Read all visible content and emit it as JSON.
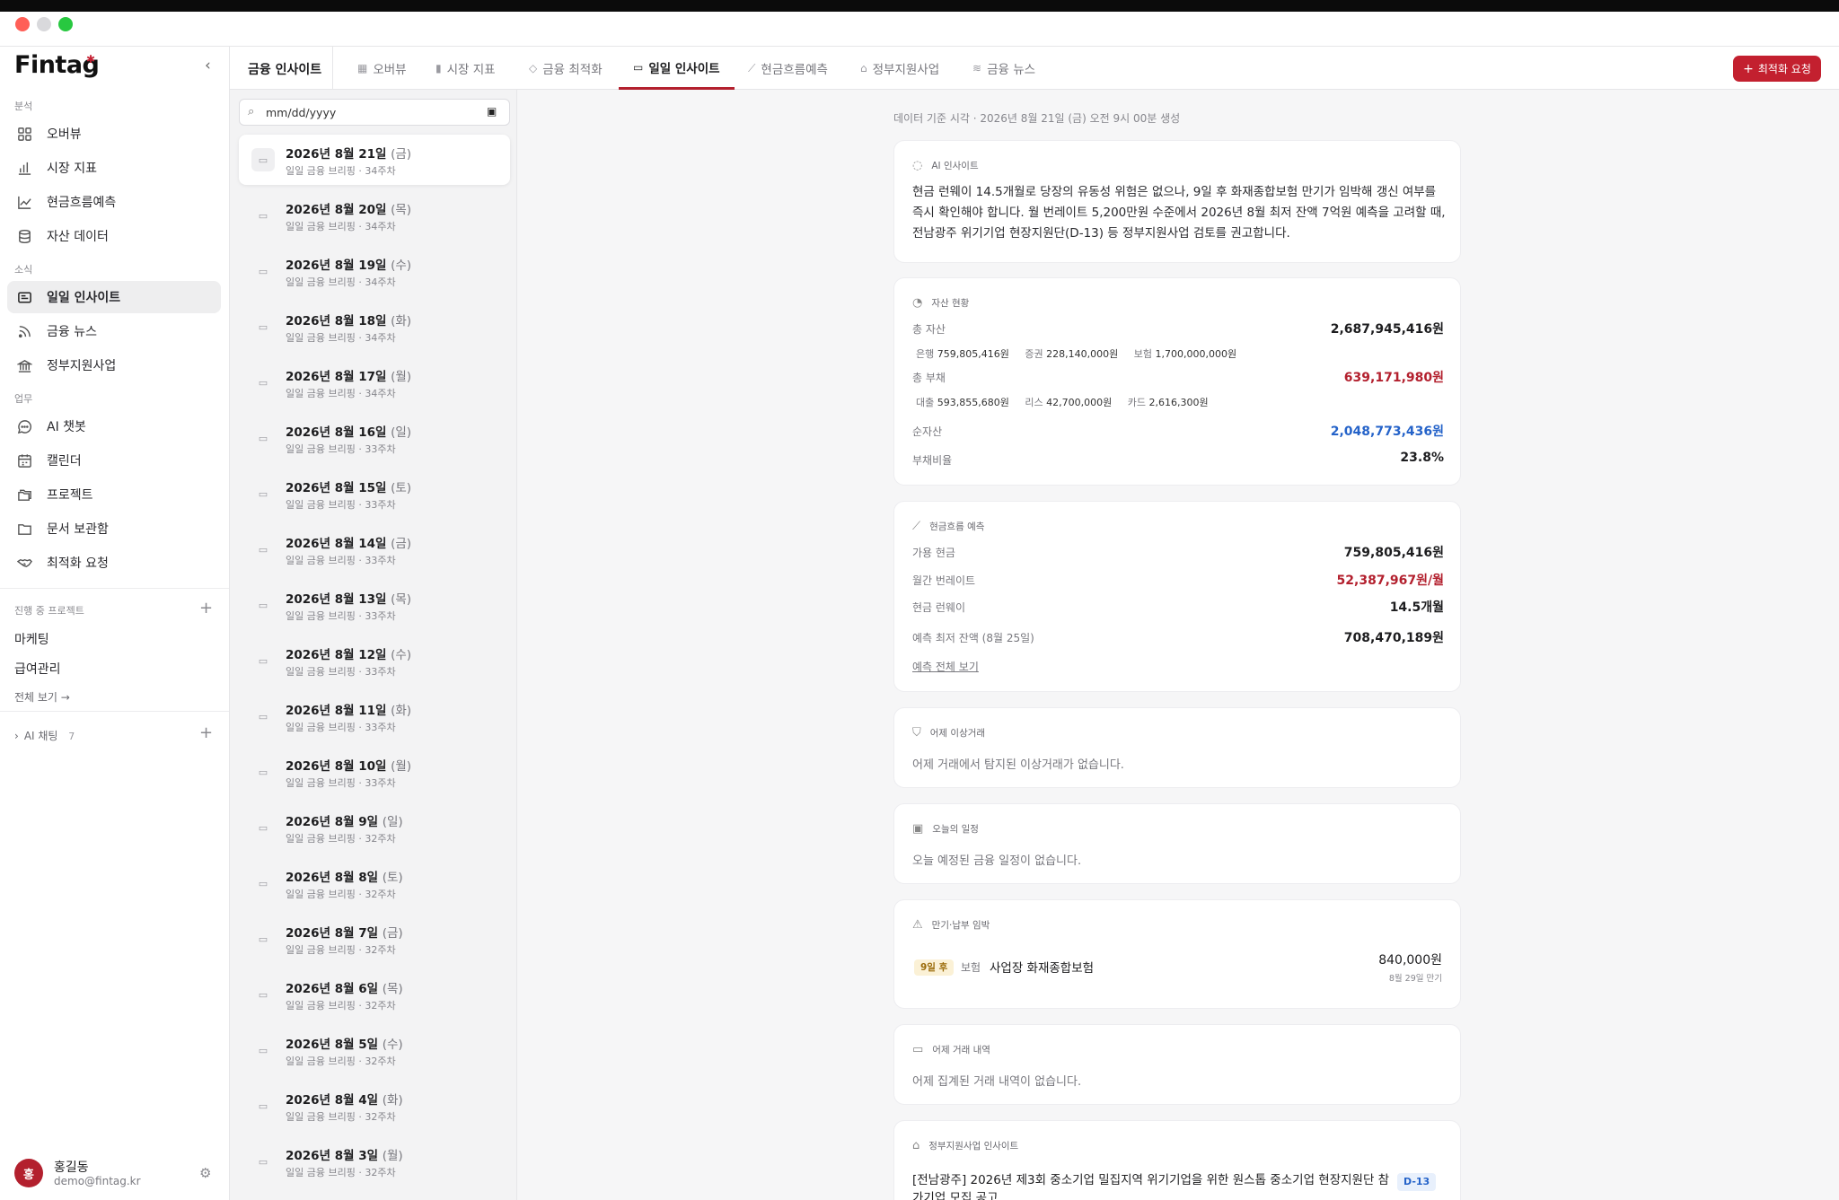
{
  "app": {
    "logo": "Fintag"
  },
  "sidebar": {
    "section_analysis": "분석",
    "section_news": "소식",
    "section_work": "업무",
    "items": [
      {
        "label": "오버뷰",
        "icon": "grid-icon"
      },
      {
        "label": "시장 지표",
        "icon": "bar-chart-icon"
      },
      {
        "label": "현금흐름예측",
        "icon": "line-chart-icon"
      },
      {
        "label": "자산 데이터",
        "icon": "database-icon"
      },
      {
        "label": "일일 인사이트",
        "icon": "newspaper-icon"
      },
      {
        "label": "금융 뉴스",
        "icon": "rss-icon"
      },
      {
        "label": "정부지원사업",
        "icon": "bank-icon"
      },
      {
        "label": "AI 챗봇",
        "icon": "chat-icon"
      },
      {
        "label": "캘린더",
        "icon": "calendar-icon"
      },
      {
        "label": "프로젝트",
        "icon": "folders-icon"
      },
      {
        "label": "문서 보관함",
        "icon": "folder-icon"
      },
      {
        "label": "최적화 요청",
        "icon": "handshake-icon"
      }
    ],
    "projects_label": "진행 중 프로젝트",
    "projects": [
      "마케팅",
      "급여관리"
    ],
    "see_all": "전체 보기 →",
    "ai_chat_label": "AI 채팅",
    "ai_chat_count": "7",
    "user": {
      "avatar": "홍",
      "name": "홍길동",
      "email": "demo@fintag.kr"
    }
  },
  "header": {
    "section_title": "금융 인사이트",
    "tabs": [
      {
        "label": "오버뷰",
        "icon": "grid-icon"
      },
      {
        "label": "시장 지표",
        "icon": "bar-chart-icon"
      },
      {
        "label": "금융 최적화",
        "icon": "handshake-icon"
      },
      {
        "label": "일일 인사이트",
        "icon": "newspaper-icon"
      },
      {
        "label": "현금흐름예측",
        "icon": "line-chart-icon"
      },
      {
        "label": "정부지원사업",
        "icon": "bank-icon"
      },
      {
        "label": "금융 뉴스",
        "icon": "rss-icon"
      }
    ],
    "request_button": "최적화 요청"
  },
  "list": {
    "date_placeholder": "mm/dd/yyyy",
    "items": [
      {
        "date": "2026년 8월 21일",
        "weekday": "(금)",
        "sub": "일일 금융 브리핑 · 34주차"
      },
      {
        "date": "2026년 8월 20일",
        "weekday": "(목)",
        "sub": "일일 금융 브리핑 · 34주차"
      },
      {
        "date": "2026년 8월 19일",
        "weekday": "(수)",
        "sub": "일일 금융 브리핑 · 34주차"
      },
      {
        "date": "2026년 8월 18일",
        "weekday": "(화)",
        "sub": "일일 금융 브리핑 · 34주차"
      },
      {
        "date": "2026년 8월 17일",
        "weekday": "(월)",
        "sub": "일일 금융 브리핑 · 34주차"
      },
      {
        "date": "2026년 8월 16일",
        "weekday": "(일)",
        "sub": "일일 금융 브리핑 · 33주차"
      },
      {
        "date": "2026년 8월 15일",
        "weekday": "(토)",
        "sub": "일일 금융 브리핑 · 33주차"
      },
      {
        "date": "2026년 8월 14일",
        "weekday": "(금)",
        "sub": "일일 금융 브리핑 · 33주차"
      },
      {
        "date": "2026년 8월 13일",
        "weekday": "(목)",
        "sub": "일일 금융 브리핑 · 33주차"
      },
      {
        "date": "2026년 8월 12일",
        "weekday": "(수)",
        "sub": "일일 금융 브리핑 · 33주차"
      },
      {
        "date": "2026년 8월 11일",
        "weekday": "(화)",
        "sub": "일일 금융 브리핑 · 33주차"
      },
      {
        "date": "2026년 8월 10일",
        "weekday": "(월)",
        "sub": "일일 금융 브리핑 · 33주차"
      },
      {
        "date": "2026년 8월 9일",
        "weekday": "(일)",
        "sub": "일일 금융 브리핑 · 32주차"
      },
      {
        "date": "2026년 8월 8일",
        "weekday": "(토)",
        "sub": "일일 금융 브리핑 · 32주차"
      },
      {
        "date": "2026년 8월 7일",
        "weekday": "(금)",
        "sub": "일일 금융 브리핑 · 32주차"
      },
      {
        "date": "2026년 8월 6일",
        "weekday": "(목)",
        "sub": "일일 금융 브리핑 · 32주차"
      },
      {
        "date": "2026년 8월 5일",
        "weekday": "(수)",
        "sub": "일일 금융 브리핑 · 32주차"
      },
      {
        "date": "2026년 8월 4일",
        "weekday": "(화)",
        "sub": "일일 금융 브리핑 · 32주차"
      },
      {
        "date": "2026년 8월 3일",
        "weekday": "(월)",
        "sub": "일일 금융 브리핑 · 32주차"
      }
    ]
  },
  "main": {
    "data_info": "데이터 기준 시각 · 2026년 8월 21일 (금) 오전 9시 00분 생성",
    "ai_insight": {
      "title": "AI 인사이트",
      "text": "현금 런웨이 14.5개월로 당장의 유동성 위험은 없으나, 9일 후 화재종합보험 만기가 임박해 갱신 여부를 즉시 확인해야 합니다. 월 번레이트 5,200만원 수준에서 2026년 8월 최저 잔액 7억원 예측을 고려할 때, 전남광주 위기기업 현장지원단(D-13) 등 정부지원사업 검토를 권고합니다."
    },
    "assets": {
      "title": "자산 현황",
      "total_assets_label": "총 자산",
      "total_assets": "2,687,945,416원",
      "bank_label": "은행",
      "bank": "759,805,416원",
      "securities_label": "증권",
      "securities": "228,140,000원",
      "insurance_label": "보험",
      "insurance": "1,700,000,000원",
      "total_debt_label": "총 부채",
      "total_debt": "639,171,980원",
      "loan_label": "대출",
      "loan": "593,855,680원",
      "lease_label": "리스",
      "lease": "42,700,000원",
      "card_label": "카드",
      "card": "2,616,300원",
      "net_label": "순자산",
      "net": "2,048,773,436원",
      "ratio_label": "부채비율",
      "ratio": "23.8%"
    },
    "cashflow": {
      "title": "현금흐름 예측",
      "available_label": "가용 현금",
      "available": "759,805,416원",
      "burn_label": "월간 번레이트",
      "burn": "52,387,967원/월",
      "runway_label": "현금 런웨이",
      "runway": "14.5개월",
      "min_label": "예측 최저 잔액 (8월 25일)",
      "min": "708,470,189원",
      "link": "예측 전체 보기"
    },
    "anomaly": {
      "title": "어제 이상거래",
      "text": "어제 거래에서 탐지된 이상거래가 없습니다."
    },
    "schedule": {
      "title": "오늘의 일정",
      "text": "오늘 예정된 금융 일정이 없습니다."
    },
    "due": {
      "title": "만기·납부 임박",
      "badge": "9일 후",
      "type": "보험",
      "name": "사업장 화재종합보험",
      "amount": "840,000원",
      "date": "8월 29일 만기"
    },
    "transactions": {
      "title": "어제 거래 내역",
      "text": "어제 집계된 거래 내역이 없습니다."
    },
    "gov": {
      "title": "정부지원사업 인사이트",
      "item": "[전남광주] 2026년 제3회 중소기업 밀집지역 위기기업을 위한 원스톱 중소기업 현장지원단 참가기업 모집 공고",
      "badge": "D-13"
    }
  }
}
